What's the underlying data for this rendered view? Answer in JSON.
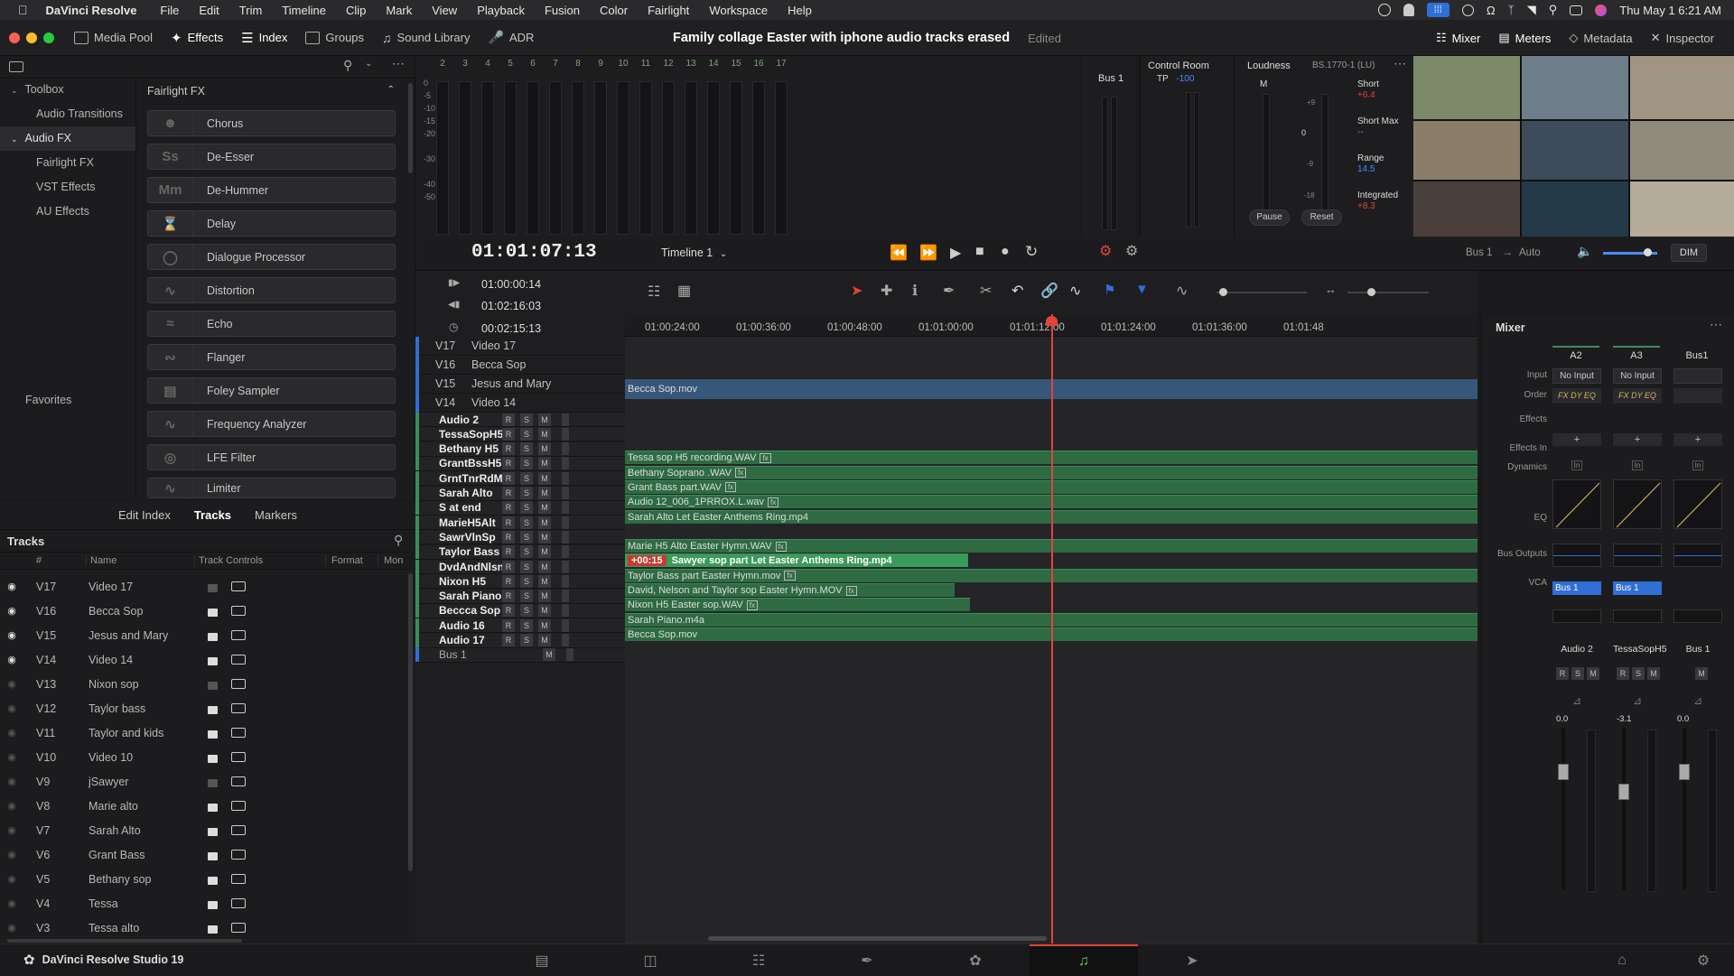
{
  "menubar": {
    "app": "DaVinci Resolve",
    "items": [
      "File",
      "Edit",
      "Trim",
      "Timeline",
      "Clip",
      "Mark",
      "View",
      "Playback",
      "Fusion",
      "Color",
      "Fairlight",
      "Workspace",
      "Help"
    ],
    "clock": "Thu May 1  6:21 AM"
  },
  "toolbar": {
    "media_pool": "Media Pool",
    "effects": "Effects",
    "index": "Index",
    "groups": "Groups",
    "sound_library": "Sound Library",
    "adr": "ADR",
    "project_title": "Family collage Easter with iphone audio tracks erased",
    "edited": "Edited",
    "mixer": "Mixer",
    "meters": "Meters",
    "metadata": "Metadata",
    "inspector": "Inspector"
  },
  "effects_tree": {
    "toolbox": "Toolbox",
    "audio_transitions": "Audio Transitions",
    "audio_fx": "Audio FX",
    "fairlight_fx": "Fairlight FX",
    "vst_effects": "VST Effects",
    "au_effects": "AU Effects",
    "favorites": "Favorites"
  },
  "fx_list": {
    "header": "Fairlight FX",
    "items": [
      "Chorus",
      "De-Esser",
      "De-Hummer",
      "Delay",
      "Dialogue Processor",
      "Distortion",
      "Echo",
      "Flanger",
      "Foley Sampler",
      "Frequency Analyzer",
      "LFE Filter",
      "Limiter"
    ]
  },
  "track_panel": {
    "tabs": [
      "Edit Index",
      "Tracks",
      "Markers"
    ],
    "title": "Tracks",
    "columns": [
      "#",
      "Name",
      "Track Controls",
      "Format",
      "Mon"
    ],
    "rows": [
      {
        "num": "V17",
        "name": "Video 17"
      },
      {
        "num": "V16",
        "name": "Becca Sop"
      },
      {
        "num": "V15",
        "name": "Jesus and Mary"
      },
      {
        "num": "V14",
        "name": "Video 14"
      },
      {
        "num": "V13",
        "name": "Nixon sop"
      },
      {
        "num": "V12",
        "name": "Taylor bass"
      },
      {
        "num": "V11",
        "name": "Taylor and kids"
      },
      {
        "num": "V10",
        "name": "Video 10"
      },
      {
        "num": "V9",
        "name": "jSawyer"
      },
      {
        "num": "V8",
        "name": "Marie alto"
      },
      {
        "num": "V7",
        "name": "Sarah Alto"
      },
      {
        "num": "V6",
        "name": "Grant Bass"
      },
      {
        "num": "V5",
        "name": "Bethany sop"
      },
      {
        "num": "V4",
        "name": "Tessa"
      },
      {
        "num": "V3",
        "name": "Tessa alto"
      }
    ]
  },
  "meters": {
    "channels": [
      "2",
      "3",
      "4",
      "5",
      "6",
      "7",
      "8",
      "9",
      "10",
      "11",
      "12",
      "13",
      "14",
      "15",
      "16",
      "17"
    ],
    "scale": [
      "0",
      "-5",
      "-10",
      "-15",
      "-20",
      "-30",
      "-40",
      "-50"
    ],
    "bus": "Bus 1"
  },
  "control_room": {
    "title": "Control Room",
    "tp": "TP",
    "tp_val": "-100",
    "loudness": "Loudness",
    "standard": "BS.1770-1 (LU)",
    "m": "M",
    "short": "Short",
    "short_val": "+6.4",
    "short_max": "Short Max",
    "short_max_val": "--",
    "range": "Range",
    "range_val": "14.5",
    "integrated": "Integrated",
    "integrated_val": "+8.3",
    "pause": "Pause",
    "reset": "Reset",
    "zero": "0",
    "plus9": "+9",
    "minus9": "-9",
    "minus18": "-18"
  },
  "transport": {
    "timecode": "01:01:07:13",
    "timeline": "Timeline 1",
    "bus": "Bus 1",
    "auto": "Auto",
    "dim": "DIM"
  },
  "timecodes": {
    "in": "01:00:00:14",
    "out": "01:02:16:03",
    "dur": "00:02:15:13"
  },
  "ruler": [
    "01:00:24:00",
    "01:00:36:00",
    "01:00:48:00",
    "01:01:00:00",
    "01:01:12:00",
    "01:01:24:00",
    "01:01:36:00",
    "01:01:48"
  ],
  "video_tracks": [
    {
      "id": "V17",
      "name": "Video 17"
    },
    {
      "id": "V16",
      "name": "Becca Sop"
    },
    {
      "id": "V15",
      "name": "Jesus and Mary"
    },
    {
      "id": "V14",
      "name": "Video 14"
    }
  ],
  "audio_tracks": [
    "Audio 2",
    "TessaSopH5",
    "Bethany H5",
    "GrantBssH5",
    "GrntTnrRdM",
    "Sarah Alto",
    "S at end",
    "MarieH5Alt",
    "SawrVlnSp",
    "Taylor Bass",
    "DvdAndNlsn",
    "Nixon H5",
    "Sarah Piano",
    "Beccca Sop",
    "Audio 16",
    "Audio 17",
    "Bus 1"
  ],
  "clips": {
    "video_v16": "Becca Sop.mov",
    "audio": [
      "",
      "Tessa sop H5 recording.WAV",
      "Bethany Soprano .WAV",
      "Grant Bass part.WAV",
      "Audio 12_006_1PRROX.L.wav",
      "Sarah Alto Let Easter Anthems Ring.mp4",
      "",
      "Marie H5 Alto Easter Hymn.WAV",
      "Sawyer sop part Let Easter Anthems Ring.mp4",
      "Taylor Bass part Easter Hymn.mov",
      "David, Nelson and Taylor sop Easter Hymn.MOV",
      "Nixon H5 Easter sop.WAV",
      "Sarah Piano.m4a",
      "Becca Sop.mov"
    ],
    "offset_badge": "+00:15"
  },
  "mixer": {
    "title": "Mixer",
    "columns": [
      "A2",
      "A3",
      "Bus1"
    ],
    "row_labels": [
      "Input",
      "Order",
      "Effects",
      "Effects In",
      "Dynamics",
      "EQ",
      "Bus Outputs",
      "VCA"
    ],
    "inputs": [
      "No Input",
      "No Input",
      ""
    ],
    "order": "FX DY EQ",
    "bus_out": "Bus 1",
    "in_label": "In",
    "names": [
      "Audio 2",
      "TessaSopH5",
      "Bus 1"
    ],
    "levels": [
      "0.0",
      "-3.1",
      "0.0"
    ]
  },
  "bottombar": {
    "app": "DaVinci Resolve Studio 19"
  }
}
